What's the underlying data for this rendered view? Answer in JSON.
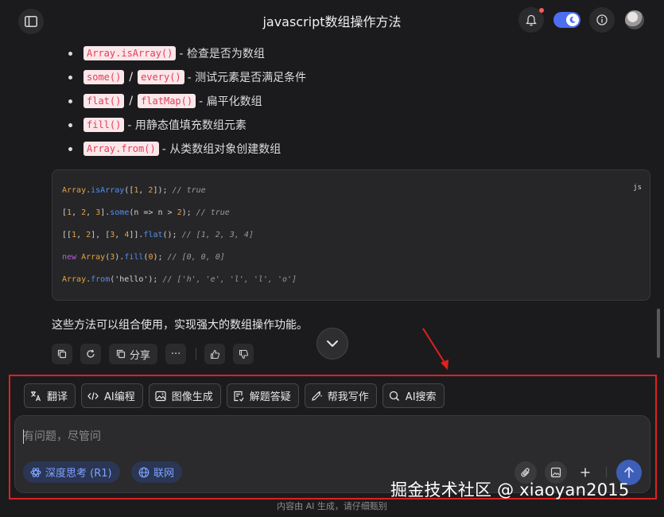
{
  "header": {
    "title": "javascript数组操作方法",
    "theme_toggle_on": true
  },
  "methods": [
    {
      "codes": [
        "Array.isArray()"
      ],
      "separator": "",
      "desc": "- 检查是否为数组"
    },
    {
      "codes": [
        "some()",
        "every()"
      ],
      "separator": "/",
      "desc": "- 测试元素是否满足条件"
    },
    {
      "codes": [
        "flat()",
        "flatMap()"
      ],
      "separator": "/",
      "desc": "- 扁平化数组"
    },
    {
      "codes": [
        "fill()"
      ],
      "separator": "",
      "desc": "- 用静态值填充数组元素"
    },
    {
      "codes": [
        "Array.from()"
      ],
      "separator": "",
      "desc": "- 从类数组对象创建数组"
    }
  ],
  "code_block": {
    "language": "js",
    "lines": [
      "Array.isArray([1, 2]); // true",
      "[1, 2, 3].some(n => n > 2); // true",
      "[[1, 2], [3, 4]].flat(); // [1, 2, 3, 4]",
      "new Array(3).fill(0); // [0, 0, 0]",
      "Array.from('hello'); // ['h', 'e', 'l', 'l', 'o']"
    ]
  },
  "summary_text": "这些方法可以组合使用，实现强大的数组操作功能。",
  "actions": {
    "share_label": "分享",
    "more_label": "···"
  },
  "tools": [
    {
      "label": "翻译",
      "icon": "translate-icon"
    },
    {
      "label": "AI编程",
      "icon": "code-icon"
    },
    {
      "label": "图像生成",
      "icon": "image-icon"
    },
    {
      "label": "解题答疑",
      "icon": "qa-icon"
    },
    {
      "label": "帮我写作",
      "icon": "pen-icon"
    },
    {
      "label": "AI搜索",
      "icon": "search-icon"
    }
  ],
  "input": {
    "placeholder": "有问题，尽管问",
    "value": ""
  },
  "toggles": {
    "deep_think": "深度思考 (R1)",
    "web": "联网"
  },
  "watermark": "掘金技术社区 @ xiaoyan2015",
  "footer": "内容由 AI 生成，请仔细甄别",
  "colors": {
    "accent": "#4e6ef2",
    "annotation": "#e02020",
    "chip_text": "#e0405a",
    "chip_bg": "#fbe7ea"
  }
}
